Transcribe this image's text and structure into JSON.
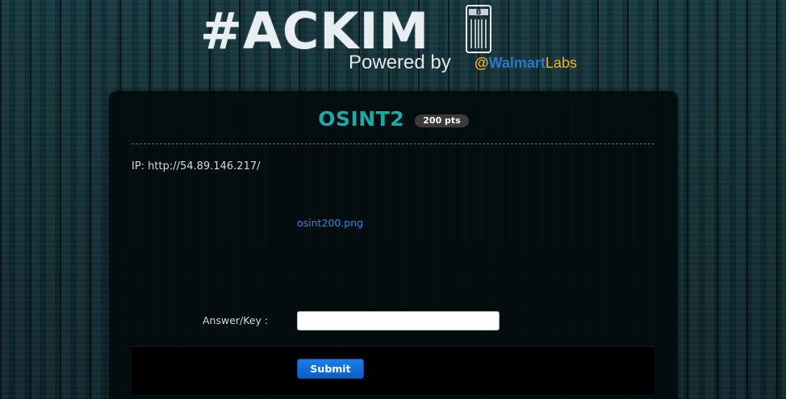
{
  "header": {
    "logo_text": "#ACKIM",
    "logo_badge_digit": "8",
    "powered_by": "Powered by",
    "sponsor_at": "@",
    "sponsor_name": "Walmart",
    "sponsor_suffix": "Labs"
  },
  "challenge": {
    "title": "OSINT2",
    "points": "200 pts",
    "description": "IP: http://54.89.146.217/",
    "attachment": "osint200.png"
  },
  "form": {
    "answer_label": "Answer/Key :",
    "answer_value": "",
    "answer_placeholder": "",
    "submit_label": "Submit"
  },
  "colors": {
    "title": "#1fa8a9",
    "link": "#2f8ad8",
    "submit": "#0a6fd6",
    "sponsor_at": "#f2b41b",
    "sponsor_name": "#2a78c8"
  },
  "icons": {
    "logo_badge": "hackathon-8-badge-icon"
  }
}
